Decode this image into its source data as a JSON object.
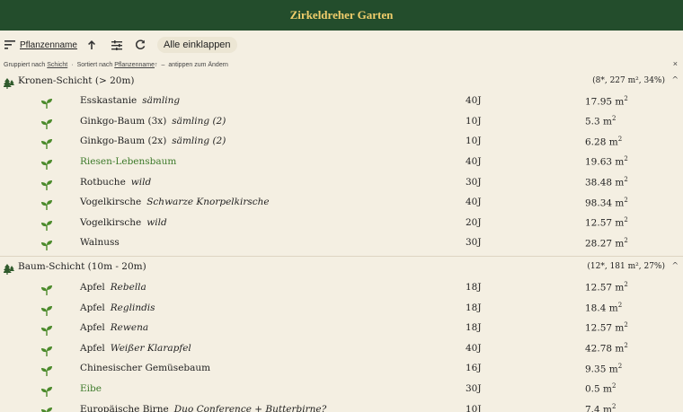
{
  "app": {
    "title": "Zirkeldreher Garten"
  },
  "toolbar": {
    "sort_field": "Pflanzenname",
    "collapse_all": "Alle einklappen"
  },
  "info": {
    "grouped_prefix": "Gruppiert nach",
    "grouped_by": "Schicht",
    "sorted_prefix": "Sortiert nach",
    "sorted_by": "Pflanzenname",
    "sorted_arrow": "↑",
    "hint": "antippen zum Ändern",
    "close": "×"
  },
  "icons": {
    "sort": "sort-icon",
    "arrow_up": "arrow-up-icon",
    "tune": "tune-icon",
    "refresh": "refresh-icon",
    "tree": "tree-icon",
    "sprout": "sprout-icon",
    "chevron_up": "chevron-up-icon"
  },
  "colors": {
    "appbar": "#234d2c",
    "title": "#f1ce6c",
    "green_text": "#3d7a2a",
    "background": "#f4efe2"
  },
  "sections": [
    {
      "title": "Kronen-Schicht (> 20m)",
      "stats": "(8*, 227 m², 34%)",
      "chevron": "^",
      "rows": [
        {
          "name": "Esskastanie",
          "variety": "sämling",
          "age": "40J",
          "area": "17.95 m",
          "green": false
        },
        {
          "name": "Ginkgo-Baum (3x)",
          "variety": "sämling (2)",
          "age": "10J",
          "area": "5.3 m",
          "green": false
        },
        {
          "name": "Ginkgo-Baum (2x)",
          "variety": "sämling (2)",
          "age": "10J",
          "area": "6.28 m",
          "green": false
        },
        {
          "name": "Riesen-Lebensbaum",
          "variety": "",
          "age": "40J",
          "area": "19.63 m",
          "green": true
        },
        {
          "name": "Rotbuche",
          "variety": "wild",
          "age": "30J",
          "area": "38.48 m",
          "green": false
        },
        {
          "name": "Vogelkirsche",
          "variety": "Schwarze Knorpelkirsche",
          "age": "40J",
          "area": "98.34 m",
          "green": false
        },
        {
          "name": "Vogelkirsche",
          "variety": "wild",
          "age": "20J",
          "area": "12.57 m",
          "green": false
        },
        {
          "name": "Walnuss",
          "variety": "",
          "age": "30J",
          "area": "28.27 m",
          "green": false
        }
      ]
    },
    {
      "title": "Baum-Schicht (10m - 20m)",
      "stats": "(12*, 181 m², 27%)",
      "chevron": "^",
      "rows": [
        {
          "name": "Apfel",
          "variety": "Rebella",
          "age": "18J",
          "area": "12.57 m",
          "green": false
        },
        {
          "name": "Apfel",
          "variety": "Reglindis",
          "age": "18J",
          "area": "18.4 m",
          "green": false
        },
        {
          "name": "Apfel",
          "variety": "Rewena",
          "age": "18J",
          "area": "12.57 m",
          "green": false
        },
        {
          "name": "Apfel",
          "variety": "Weißer Klarapfel",
          "age": "40J",
          "area": "42.78 m",
          "green": false
        },
        {
          "name": "Chinesischer Gemüsebaum",
          "variety": "",
          "age": "16J",
          "area": "9.35 m",
          "green": false
        },
        {
          "name": "Eibe",
          "variety": "",
          "age": "30J",
          "area": "0.5 m",
          "green": true
        },
        {
          "name": "Europäische Birne",
          "variety": "Duo Conference + Butterbirne?",
          "age": "10J",
          "area": "7.4 m",
          "green": false
        }
      ]
    }
  ],
  "area_unit_sup": "2"
}
